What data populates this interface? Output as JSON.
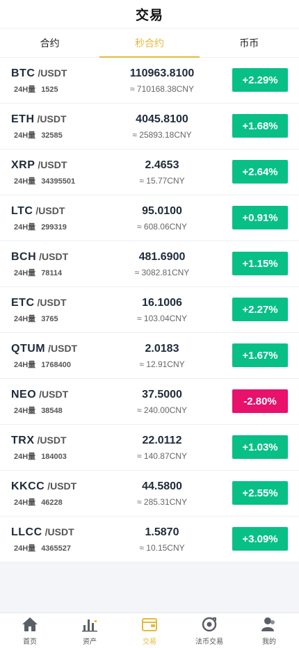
{
  "header": {
    "title": "交易"
  },
  "tabs": [
    {
      "label": "合约",
      "active": false
    },
    {
      "label": "秒合约",
      "active": true
    },
    {
      "label": "币币",
      "active": false
    }
  ],
  "markets": [
    {
      "base": "BTC",
      "quote": "/USDT",
      "vol_label": "24H量",
      "volume": "1525",
      "price": "110963.8100",
      "cny": "≈ 710168.38CNY",
      "change": "+2.29%",
      "direction": "up"
    },
    {
      "base": "ETH",
      "quote": "/USDT",
      "vol_label": "24H量",
      "volume": "32585",
      "price": "4045.8100",
      "cny": "≈ 25893.18CNY",
      "change": "+1.68%",
      "direction": "up"
    },
    {
      "base": "XRP",
      "quote": "/USDT",
      "vol_label": "24H量",
      "volume": "34395501",
      "price": "2.4653",
      "cny": "≈ 15.77CNY",
      "change": "+2.64%",
      "direction": "up"
    },
    {
      "base": "LTC",
      "quote": "/USDT",
      "vol_label": "24H量",
      "volume": "299319",
      "price": "95.0100",
      "cny": "≈ 608.06CNY",
      "change": "+0.91%",
      "direction": "up"
    },
    {
      "base": "BCH",
      "quote": "/USDT",
      "vol_label": "24H量",
      "volume": "78114",
      "price": "481.6900",
      "cny": "≈ 3082.81CNY",
      "change": "+1.15%",
      "direction": "up"
    },
    {
      "base": "ETC",
      "quote": "/USDT",
      "vol_label": "24H量",
      "volume": "3765",
      "price": "16.1006",
      "cny": "≈ 103.04CNY",
      "change": "+2.27%",
      "direction": "up"
    },
    {
      "base": "QTUM",
      "quote": "/USDT",
      "vol_label": "24H量",
      "volume": "1768400",
      "price": "2.0183",
      "cny": "≈ 12.91CNY",
      "change": "+1.67%",
      "direction": "up"
    },
    {
      "base": "NEO",
      "quote": "/USDT",
      "vol_label": "24H量",
      "volume": "38548",
      "price": "37.5000",
      "cny": "≈ 240.00CNY",
      "change": "-2.80%",
      "direction": "down"
    },
    {
      "base": "TRX",
      "quote": "/USDT",
      "vol_label": "24H量",
      "volume": "184003",
      "price": "22.0112",
      "cny": "≈ 140.87CNY",
      "change": "+1.03%",
      "direction": "up"
    },
    {
      "base": "KKCC",
      "quote": "/USDT",
      "vol_label": "24H量",
      "volume": "46228",
      "price": "44.5800",
      "cny": "≈ 285.31CNY",
      "change": "+2.55%",
      "direction": "up"
    },
    {
      "base": "LLCC",
      "quote": "/USDT",
      "vol_label": "24H量",
      "volume": "4365527",
      "price": "1.5870",
      "cny": "≈ 10.15CNY",
      "change": "+3.09%",
      "direction": "up"
    }
  ],
  "bottom_nav": [
    {
      "label": "首页",
      "icon": "home-icon",
      "active": false
    },
    {
      "label": "资产",
      "icon": "assets-chart-icon",
      "active": false
    },
    {
      "label": "交易",
      "icon": "trade-wallet-icon",
      "active": true
    },
    {
      "label": "法币交易",
      "icon": "fiat-exchange-icon",
      "active": false
    },
    {
      "label": "我的",
      "icon": "profile-icon",
      "active": false
    }
  ],
  "colors": {
    "accent": "#e5b93a",
    "up": "#08c086",
    "down": "#e8116b"
  }
}
